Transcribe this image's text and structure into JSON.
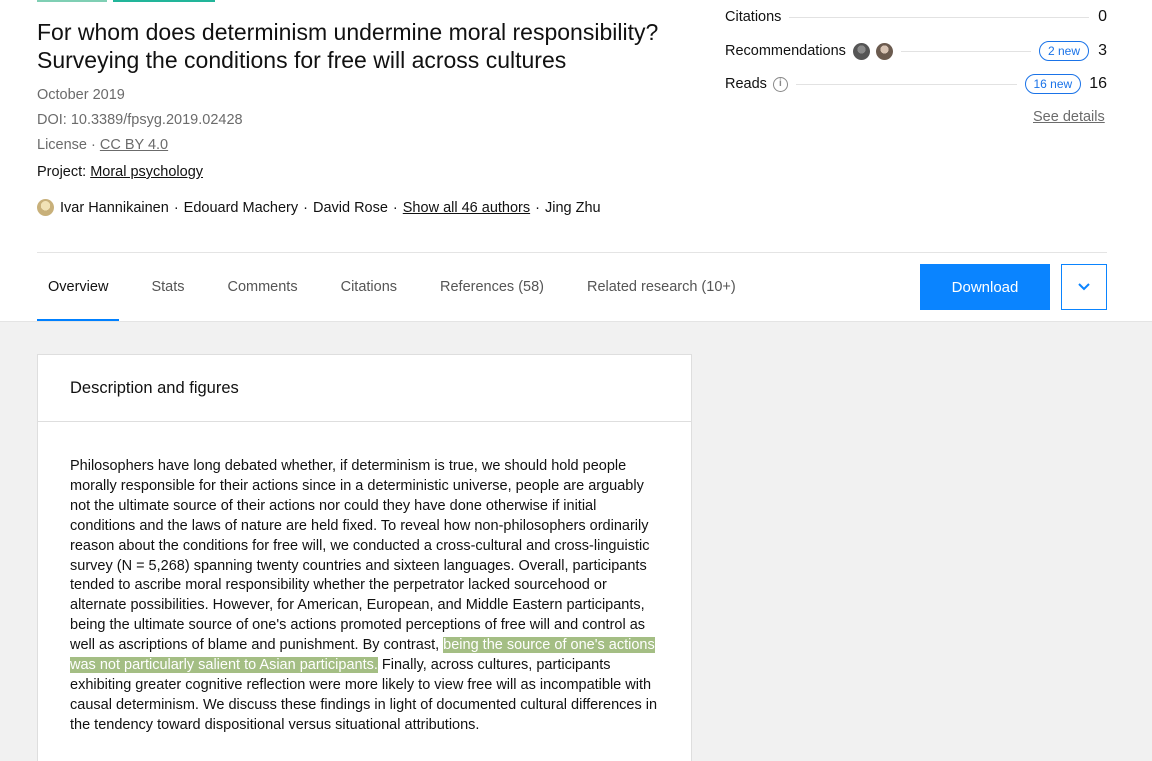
{
  "colors": {
    "accent": "#0a84ff",
    "highlight": "#a4be84",
    "tab_indicator": "#0080ff"
  },
  "paper": {
    "title_line1": "For whom does determinism undermine moral responsibility?",
    "title_line2": "Surveying the conditions for free will across cultures",
    "date": "October 2019",
    "doi": "DOI: 10.3389/fpsyg.2019.02428",
    "license_prefix": "License · ",
    "license": "CC BY 4.0",
    "project_prefix": "Project: ",
    "project": "Moral psychology",
    "authors": [
      "Ivar Hannikainen",
      "Edouard Machery",
      "David Rose"
    ],
    "show_all": "Show all 46 authors",
    "last_author": "Jing Zhu",
    "separator": "·"
  },
  "stats": {
    "citations_label": "Citations",
    "citations_value": "0",
    "recommendations_label": "Recommendations",
    "recommendations_new": "2 new",
    "recommendations_value": "3",
    "reads_label": "Reads",
    "reads_new": "16 new",
    "reads_value": "16",
    "see_details": "See details"
  },
  "tabs": [
    {
      "label": "Overview",
      "active": true
    },
    {
      "label": "Stats"
    },
    {
      "label": "Comments"
    },
    {
      "label": "Citations"
    },
    {
      "label": "References (58)"
    },
    {
      "label": "Related research (10+)"
    }
  ],
  "actions": {
    "download": "Download",
    "more_icon": "chevron-down-icon"
  },
  "description": {
    "heading": "Description and figures",
    "abstract_before": "Philosophers have long debated whether, if determinism is true, we should hold people morally responsible for their actions since in a deterministic universe, people are arguably not the ultimate source of their actions nor could they have done otherwise if initial conditions and the laws of nature are held fixed. To reveal how non-philosophers ordinarily reason about the conditions for free will, we conducted a cross-cultural and cross-linguistic survey (N = 5,268) spanning twenty countries and sixteen languages. Overall, participants tended to ascribe moral responsibility whether the perpetrator lacked sourcehood or alternate possibilities. However, for American, European, and Middle Eastern participants, being the ultimate source of one's actions promoted perceptions of free will and control as well as ascriptions of blame and punishment. By contrast, ",
    "abstract_highlight": "being the source of one's actions was not particularly salient to Asian participants.",
    "abstract_after": " Finally, across cultures, participants exhibiting greater cognitive reflection were more likely to view free will as incompatible with causal determinism. We discuss these findings in light of documented cultural differences in the tendency toward dispositional versus situational attributions."
  }
}
